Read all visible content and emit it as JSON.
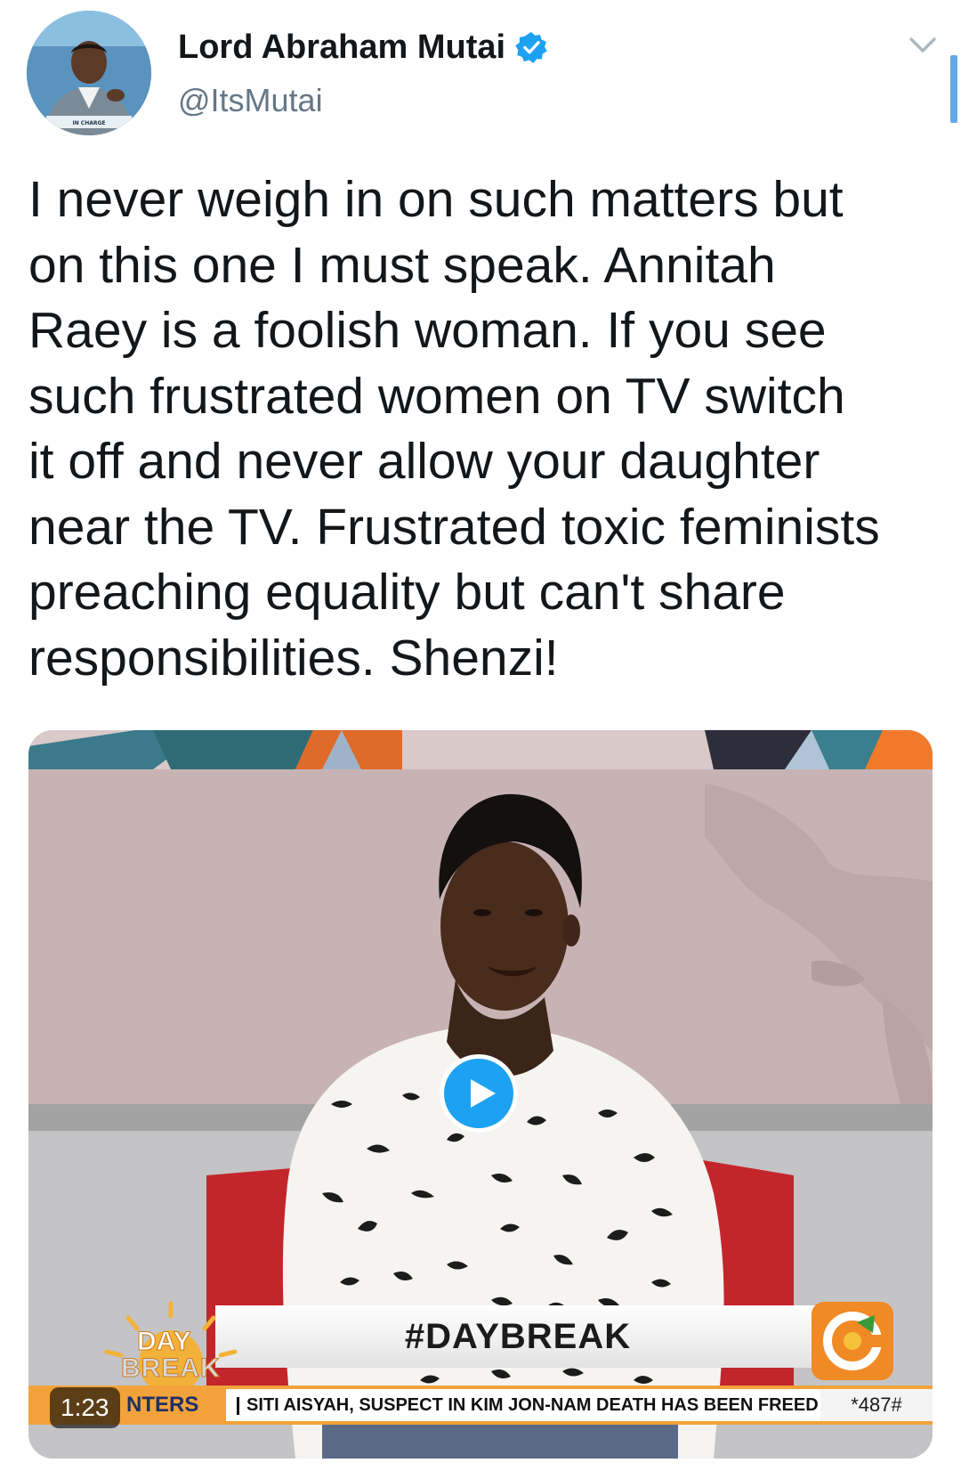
{
  "author": {
    "display_name": "Lord Abraham Mutai",
    "handle": "@ItsMutai",
    "verified": true,
    "avatar_icon": "profile-photo",
    "avatar_caption": "IN CHARGE"
  },
  "tweet": {
    "text": "I never weigh in on such matters but\non this one I must speak. Annitah\nRaey is a foolish woman. If you see\nsuch frustrated women on TV switch\nit off and never allow your daughter\nnear the TV. Frustrated toxic feminists\npreaching equality but can't share\nresponsibilities. Shenzi!"
  },
  "media": {
    "type": "video",
    "duration": "1:23",
    "hashtag": "#DAYBREAK",
    "show_logo_top": "DAY",
    "show_logo_bottom": "BREAK",
    "ticker_label": "NTERS",
    "ticker_headline": "SITI AISYAH, SUSPECT IN KIM JON-NAM DEATH HAS BEEN FREED",
    "ticker_code": "*487#",
    "play_icon": "play-icon",
    "channel_logo_icon": "citizen-tv-logo"
  },
  "colors": {
    "verified_blue": "#1da1f2",
    "text_primary": "#14171a",
    "text_secondary": "#657786",
    "ticker_orange": "#f2a23a",
    "channel_orange": "#f08a24"
  }
}
